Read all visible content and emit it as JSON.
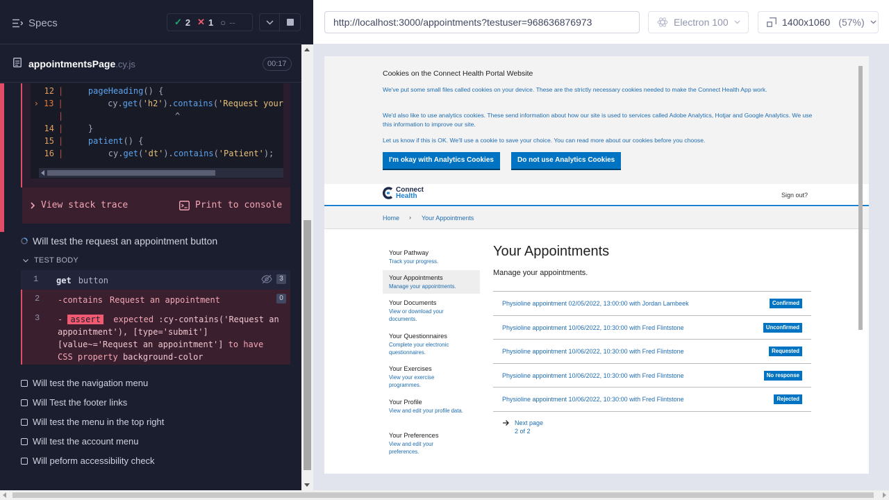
{
  "reporter": {
    "specs_label": "Specs",
    "stats": {
      "passed": "2",
      "failed": "1",
      "pending": "--"
    },
    "spec": {
      "name": "appointmentsPage",
      "ext": ".cy.js",
      "duration": "00:17"
    },
    "code_lines": [
      {
        "num": "12",
        "code_pre": "    ",
        "fn": "pageHeading",
        "rest": "() {"
      },
      {
        "num": "13",
        "code_pre": "        cy.",
        "fn": "get",
        "str1": "'h2'",
        "mid": ").",
        "fn2": "contains",
        "str2": "'Request your"
      },
      {
        "num": "",
        "caret": "^"
      },
      {
        "num": "14",
        "code": "    }"
      },
      {
        "num": "15",
        "code_pre": "    ",
        "fn": "patient",
        "rest": "() {"
      },
      {
        "num": "16",
        "code_pre": "        cy.",
        "fn": "get",
        "str1": "'dt'",
        "mid": ").",
        "fn2": "contains",
        "str2": "'Patient'",
        "end": ");"
      }
    ],
    "err_actions": {
      "stack": "View stack trace",
      "print": "Print to console"
    },
    "running_test": "Will test the request an appointment button",
    "test_body_label": "TEST BODY",
    "commands": [
      {
        "num": "1",
        "name": "get",
        "arg": "button",
        "count": "3"
      },
      {
        "num": "2",
        "name": "-contains",
        "arg": "Request an appointment",
        "count": "0"
      },
      {
        "num": "3",
        "badge": "assert",
        "t1": "expected",
        "t2": ":cy-contains('Request an appointment'), [type='submit'][value~='Request an appointment']",
        "t3": "to have CSS property",
        "t4": "background-color"
      }
    ],
    "tests": [
      "Will test the navigation menu",
      "Will Test the footer links",
      "Will test the menu in the top right",
      "Will test the account menu",
      "Will peform accessibility check"
    ]
  },
  "toolbar": {
    "url": "http://localhost:3000/appointments?testuser=968636876973",
    "browser": "Electron 100",
    "viewport": "1400x1060",
    "scale": "(57%)"
  },
  "site": {
    "cookie": {
      "title": "Cookies on the Connect Health Portal Website",
      "p1": "We've put some small files called cookies on your device. These are the strictly necessary cookies needed to make the Connect Health App work.",
      "p2": "We'd also like to use analytics cookies. These send information about how our site is used to services called Adobe Analytics, Hotjar and Google Analytics. We use this information to improve our site.",
      "p3": "Let us know if this is OK. We'll use a cookie to save your choice. You can read more about our cookies before you choose.",
      "accept": "I'm okay with Analytics Cookies",
      "reject": "Do not use Analytics Cookies"
    },
    "logo": {
      "line1": "Connect",
      "line2": "Health"
    },
    "signout": "Sign out?",
    "breadcrumb": {
      "home": "Home",
      "sep": "›",
      "current": "Your Appointments"
    },
    "nav": [
      {
        "title": "Your Pathway",
        "desc": "Track your progress."
      },
      {
        "title": "Your Appointments",
        "desc": "Manage your appointments."
      },
      {
        "title": "Your Documents",
        "desc": "View or download your documents."
      },
      {
        "title": "Your Questionnaires",
        "desc": "Complete your electronic questionnaires."
      },
      {
        "title": "Your Exercises",
        "desc": "View your exercise programmes."
      },
      {
        "title": "Your Profile",
        "desc": "View and edit your profile data."
      },
      {
        "title": "Your Preferences",
        "desc": "View and edit your preferences."
      }
    ],
    "page_title": "Your Appointments",
    "page_sub": "Manage your appointments.",
    "appointments": [
      {
        "text": "Physioline appointment 02/05/2022, 13:00:00 with Jordan Lambeek",
        "status": "Confirmed"
      },
      {
        "text": "Physioline appointment 10/06/2022, 10:30:00 with Fred Flintstone",
        "status": "Unconfirmed"
      },
      {
        "text": "Physioline appointment 10/06/2022, 10:30:00 with Fred Flintstone",
        "status": "Requested"
      },
      {
        "text": "Physioline appointment 10/06/2022, 10:30:00 with Fred Flintstone",
        "status": "No response"
      },
      {
        "text": "Physioline appointment 10/06/2022, 10:30:00 with Fred Flintstone",
        "status": "Rejected"
      }
    ],
    "next_page": {
      "label": "Next page",
      "pages": "2 of 2"
    }
  }
}
